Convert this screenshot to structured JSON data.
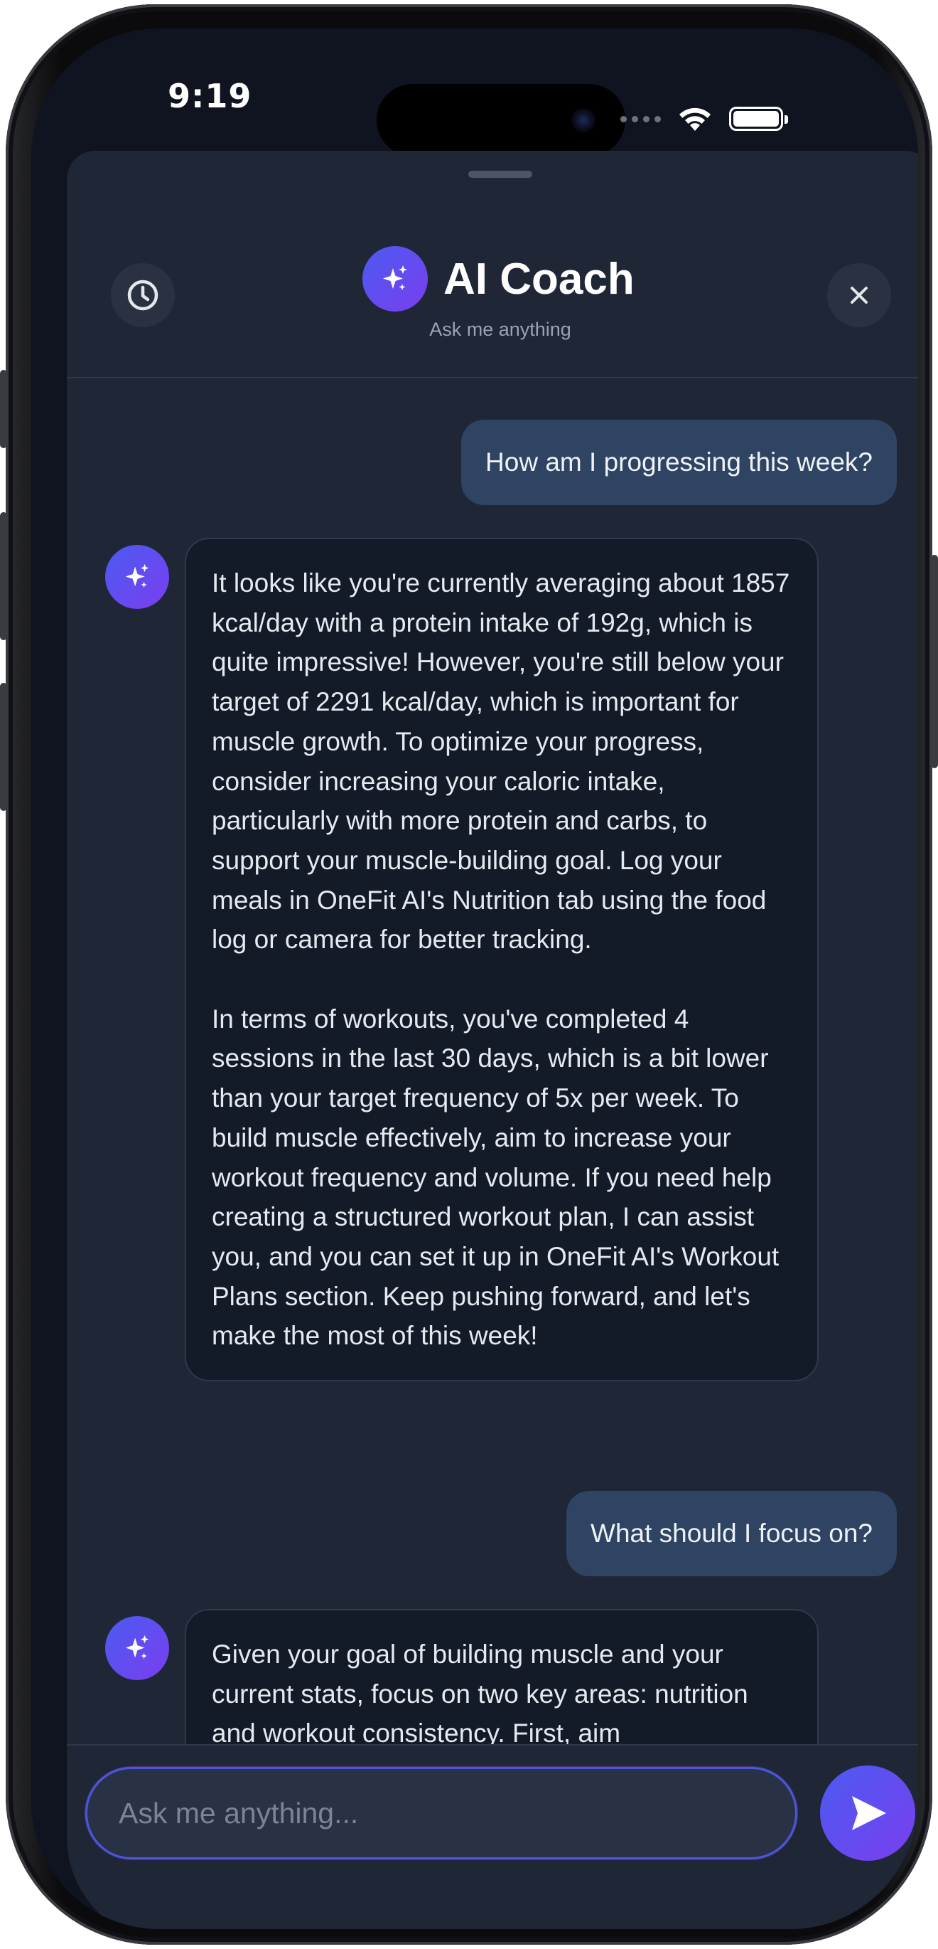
{
  "status_bar": {
    "time": "9:19"
  },
  "header": {
    "title": "AI Coach",
    "subtitle": "Ask me anything",
    "left_icon": "history-clock-icon",
    "right_icon": "close-icon",
    "logo_icon": "sparkles-icon"
  },
  "messages": [
    {
      "role": "user",
      "text": "How am I progressing this week?"
    },
    {
      "role": "assistant",
      "paragraphs": [
        "It looks like you're currently averaging about 1857 kcal/day with a protein intake of 192g, which is quite impressive! However, you're still below your target of 2291 kcal/day, which is important for muscle growth. To optimize your progress, consider increasing your caloric intake, particularly with more protein and carbs, to support your muscle-building goal. Log your meals in OneFit AI's Nutrition tab using the food log or camera for better tracking.",
        "In terms of workouts, you've completed 4 sessions in the last 30 days, which is a bit lower than your target frequency of 5x per week. To build muscle effectively, aim to increase your workout frequency and volume. If you need help creating a structured workout plan, I can assist you, and you can set it up in OneFit AI's Workout Plans section. Keep pushing forward, and let's make the most of this week!"
      ]
    },
    {
      "role": "user",
      "text": "What should I focus on?"
    },
    {
      "role": "assistant",
      "paragraphs": [
        "Given your goal of building muscle and your current stats, focus on two key areas: nutrition and workout consistency. First, aim"
      ]
    }
  ],
  "composer": {
    "placeholder": "Ask me anything...",
    "send_icon": "send-icon"
  },
  "colors": {
    "background": "#1f2635",
    "accent_start": "#4b5bf0",
    "accent_end": "#7a3ef0",
    "user_bubble": "#2e4462",
    "assistant_bubble": "#131a28"
  }
}
